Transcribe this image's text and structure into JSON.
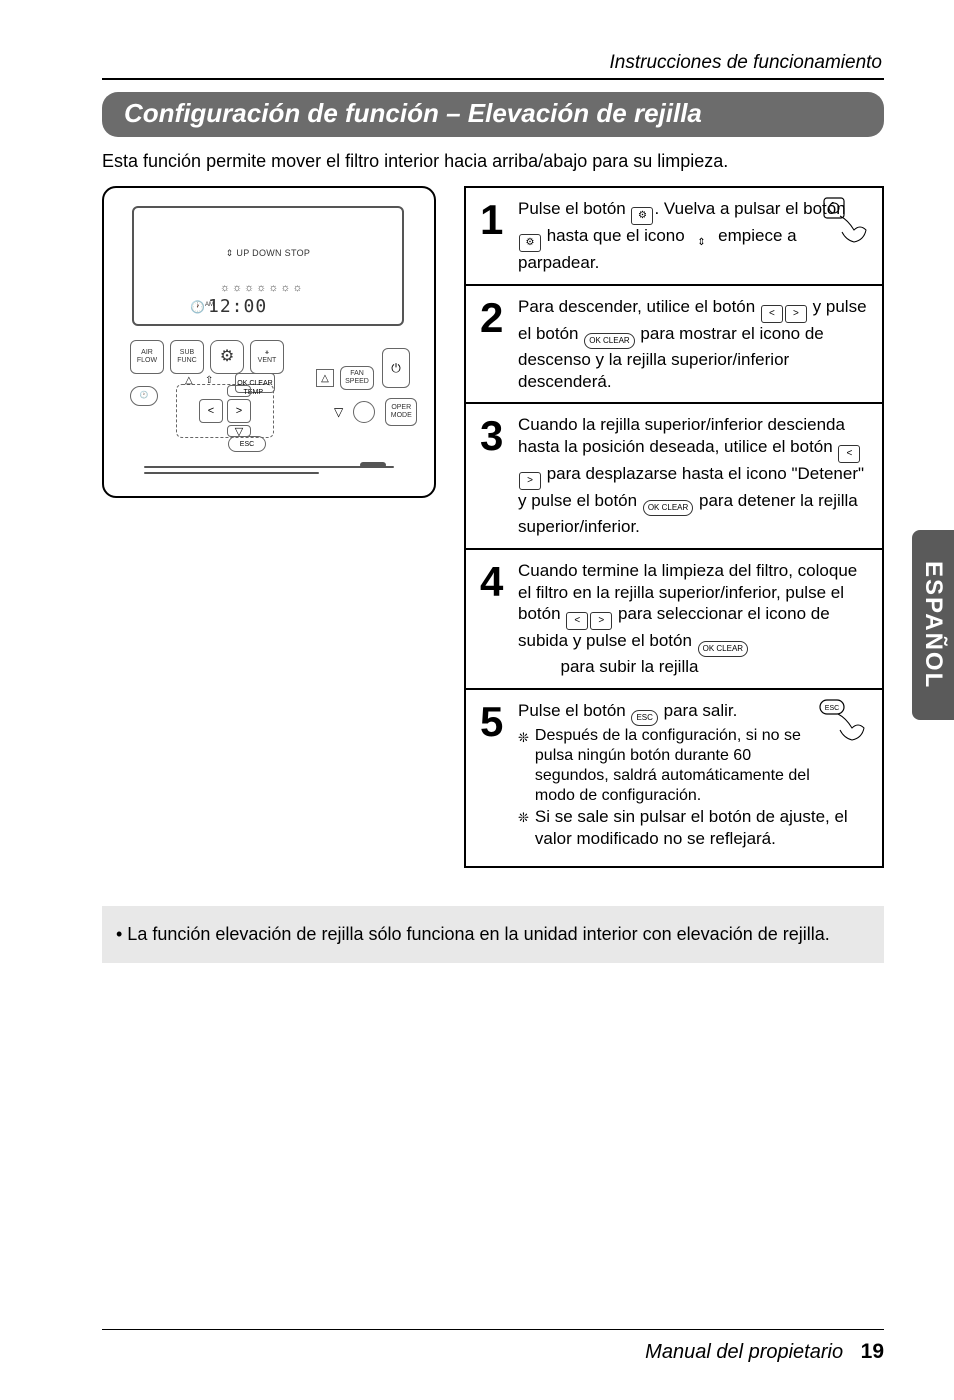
{
  "header_caption": "Instrucciones de funcionamiento",
  "title": "Configuración de función – Elevación de rejilla",
  "intro": "Esta función permite mover el filtro interior hacia arriba/abajo para su limpieza.",
  "remote": {
    "lcd_status": "⇕ UP DOWN STOP",
    "lcd_icons": "☼☼☼☼☼☼☼",
    "clock_ampm": "AM",
    "time": "12:00",
    "air_flow": "AIR FLOW",
    "sub_func": "SUB FUNC",
    "gear": "⚙",
    "vent": "VENT",
    "fan_speed": "FAN SPEED",
    "ok_clear": "OK CLEAR",
    "temp": "TEMP",
    "oper_mode": "OPER MODE",
    "esc": "ESC"
  },
  "steps": [
    {
      "n": "1",
      "text_a": "Pulse el botón ",
      "icon_a": "⚙",
      "text_b": ". Vuelva a pulsar el botón ",
      "icon_b": "⚙",
      "text_c": " hasta que el icono ",
      "icon_c": "⇕",
      "text_d": " empiece a parpadear."
    },
    {
      "n": "2",
      "text_a": "Para descender, utilice el botón ",
      "icon_a": "<",
      "icon_b": ">",
      "text_b": " y pulse el botón ",
      "icon_c": "OK CLEAR",
      "text_c": " para mostrar el icono de descenso y la rejilla superior/inferior descenderá."
    },
    {
      "n": "3",
      "text_a": "Cuando la rejilla superior/inferior descienda hasta la posición deseada, utilice el botón ",
      "icon_a": "<",
      "icon_b": ">",
      "text_b": " para desplazarse hasta el icono \"Detener\" y pulse el botón ",
      "icon_c": "OK CLEAR",
      "text_c": " para detener la rejilla superior/inferior."
    },
    {
      "n": "4",
      "text_a": "Cuando termine la limpieza del filtro, coloque el filtro en la rejilla superior/inferior, pulse el botón ",
      "icon_a": "<",
      "icon_b": ">",
      "text_b": " para seleccionar el icono de subida y pulse el botón ",
      "icon_c": "OK CLEAR",
      "text_c": "         para subir la rejilla"
    },
    {
      "n": "5",
      "text_a": "Pulse el botón ",
      "icon_a": "ESC",
      "text_b": " para salir.",
      "note1": "Después de la configuración, si no se pulsa ningún botón durante 60 segundos, saldrá automáticamente del modo de configuración.",
      "note2": "Si se sale sin pulsar el botón de ajuste, el valor modificado no se reflejará."
    }
  ],
  "footnote": "• La función elevación de rejilla sólo funciona en la unidad interior con elevación de rejilla.",
  "side_tab": "ESPAÑOL",
  "footer_label": "Manual del propietario",
  "page_number": "19"
}
